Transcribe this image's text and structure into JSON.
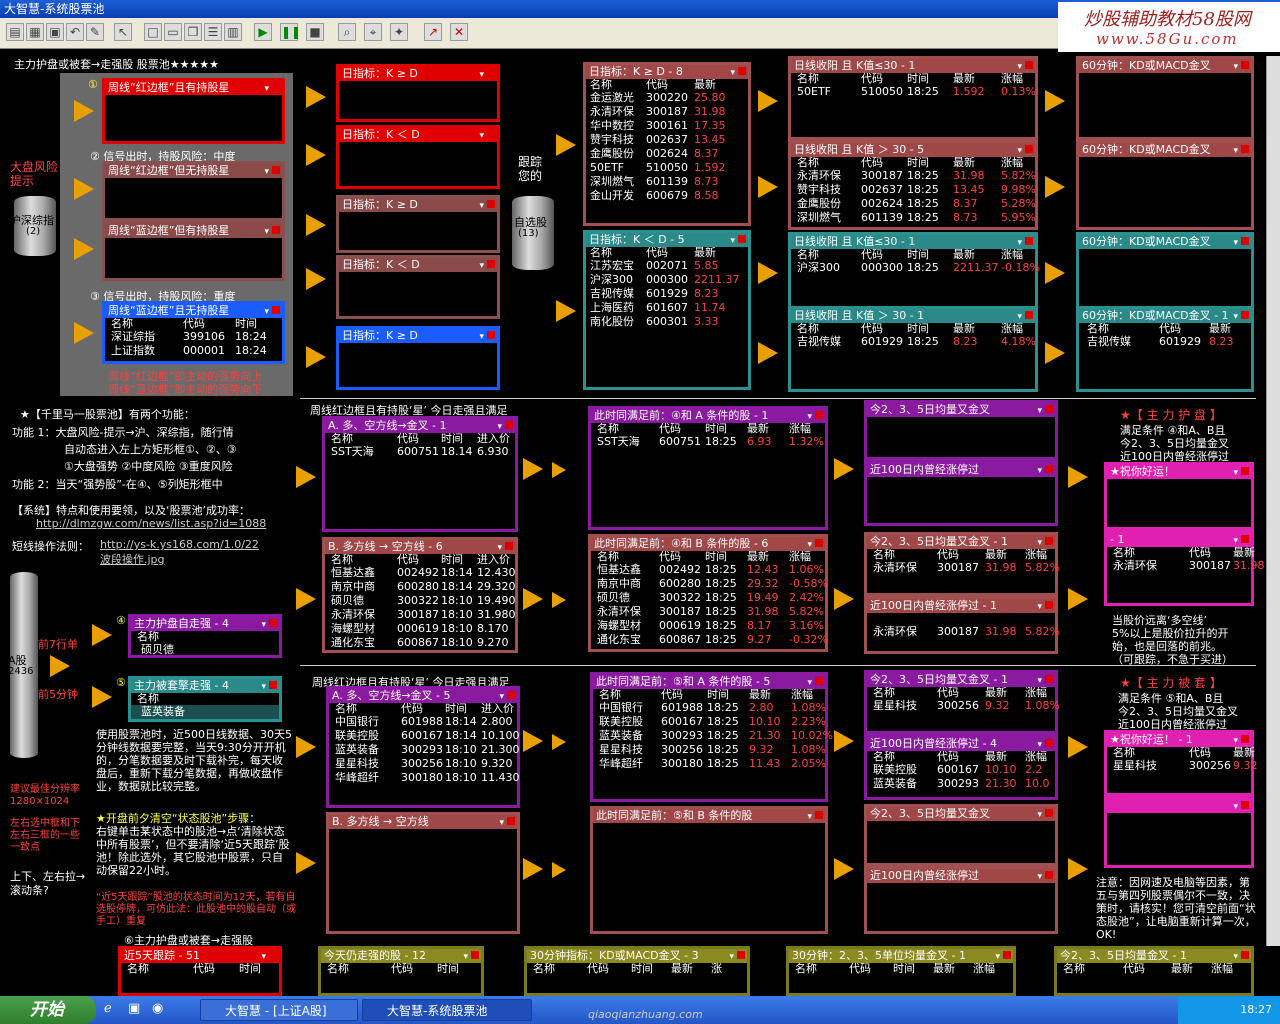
{
  "window": {
    "title": "大智慧-系统股票池"
  },
  "brand": {
    "line1": "炒股辅助教材58股网",
    "line2": "www.58Gu.com"
  },
  "header": {
    "subtitle": "主力护盘或被套→走强股  股票池★★★★★"
  },
  "left": {
    "p1_num": "①",
    "p1_title": "周线“红边框”且有持股星",
    "p2_label": "② 信号出时，持股风险：中度",
    "p2a_title": "周线“红边框”但无持股星",
    "p2b_title": "周线“蓝边框”但有持股星",
    "p3_label": "③ 信号出时，持股风险：重度",
    "p3_title": "周线“蓝边框”且无持股星",
    "p3_cols": [
      "名称",
      "代码",
      "时间"
    ],
    "p3_rows": [
      [
        "深证综指",
        "399106",
        "18:24"
      ],
      [
        "上证指数",
        "000001",
        "18:24"
      ]
    ],
    "warn_label": "大盘风险提示",
    "index_label": "沪深综指",
    "index_count": "(2)",
    "note1": "周线“红边框”即主动的强势向上",
    "note2": "周线“蓝边框”即主动的强势向下"
  },
  "col2": {
    "k1": "日指标：K ≥ D",
    "k2": "日指标：K ＜ D",
    "k3": "日指标：K ≥ D",
    "k4": "日指标：K ＜ D",
    "k5": "日指标：K ≥ D"
  },
  "track": {
    "label": "跟踪您的",
    "pool": "自选股",
    "count": "(13)"
  },
  "kd_up": {
    "title": "日指标：K ≥ D - 8",
    "cols": [
      "名称",
      "代码",
      "最新"
    ],
    "rows": [
      [
        "金运激光",
        "300220",
        "25.80"
      ],
      [
        "永清环保",
        "300187",
        "31.98"
      ],
      [
        "华中数控",
        "300161",
        "17.35"
      ],
      [
        "赞宇科技",
        "002637",
        "13.45"
      ],
      [
        "金鹰股份",
        "002624",
        "8.37"
      ],
      [
        "50ETF",
        "510050",
        "1.592"
      ],
      [
        "深圳燃气",
        "601139",
        "8.73"
      ],
      [
        "金山开发",
        "600679",
        "8.58"
      ]
    ]
  },
  "kd_down": {
    "title": "日指标：K ＜ D - 5",
    "cols": [
      "名称",
      "代码",
      "最新"
    ],
    "rows": [
      [
        "江苏宏宝",
        "002071",
        "5.85"
      ],
      [
        "沪深300",
        "000300",
        "2211.37"
      ],
      [
        "吉视传媒",
        "601929",
        "8.23"
      ],
      [
        "上海医药",
        "601607",
        "11.74"
      ],
      [
        "南化股份",
        "600301",
        "3.33"
      ]
    ]
  },
  "daily": {
    "a_title": "日线收阳 且 K值≤30 - 1",
    "cols": [
      "名称",
      "代码",
      "时间",
      "最新",
      "涨幅"
    ],
    "a_rows": [
      [
        "50ETF",
        "510050",
        "18:25",
        "1.592",
        "0.13%"
      ]
    ],
    "b_title": "日线收阳 且 K值 ＞ 30 - 5",
    "b_rows": [
      [
        "永清环保",
        "300187",
        "18:25",
        "31.98",
        "5.82%"
      ],
      [
        "赞宇科技",
        "002637",
        "18:25",
        "13.45",
        "9.98%"
      ],
      [
        "金鹰股份",
        "002624",
        "18:25",
        "8.37",
        "5.28%"
      ],
      [
        "深圳燃气",
        "601139",
        "18:25",
        "8.73",
        "5.95%"
      ]
    ],
    "c_title": "日线收阳 且 K值≤30 - 1",
    "c_rows": [
      [
        "沪深300",
        "000300",
        "18:25",
        "2211.37",
        "-0.18%"
      ]
    ],
    "d_title": "日线收阳 且 K值 ＞ 30 - 1",
    "d_rows": [
      [
        "吉视传媒",
        "601929",
        "18:25",
        "8.23",
        "4.18%"
      ]
    ]
  },
  "min60": {
    "a": "60分钟：KD或MACD金叉",
    "b": "60分钟：KD或MACD金叉",
    "c": "60分钟：KD或MACD金叉",
    "d": "60分钟：KD或MACD金叉 - 1",
    "d_cols": [
      "名称",
      "代码",
      "最新"
    ],
    "d_rows": [
      [
        "吉视传媒",
        "601929",
        "8.23"
      ]
    ]
  },
  "intro": {
    "title": "★【千里马一股票池】有两个功能：",
    "f1a": "功能 1：大盘风险-提示→沪、深综指，随行情",
    "f1b": "自动态进入左上方矩形框①、②、③",
    "f1c": "①大盘强势 ②中度风险 ③重度风险",
    "f2": "功能 2：当天“强势股”-在④、⑤列矩形框中",
    "sys": "【系统】特点和使用要领，以及‘股票池’成功率：",
    "url1": "http://dlmzgw.com/news/list.asp?id=1088",
    "law": "短线操作法则：",
    "url2": "http://ys-k.ys168.com/1.0/22",
    "url2b": "波段操作.jpg"
  },
  "row4": {
    "heading": "周线红边框且有持股‘星’ 今日走强且满足",
    "a_title": "A. 多、空方线→金叉 - 1",
    "a_cols": [
      "名称",
      "代码",
      "时间",
      "进入价"
    ],
    "a_rows": [
      [
        "SST天海",
        "600751",
        "18.14",
        "6.930"
      ]
    ],
    "b_title": "B. 多方线 → 空方线 - 6",
    "b_rows": [
      [
        "恒基达鑫",
        "002492",
        "18:14",
        "12.430"
      ],
      [
        "南京中商",
        "600280",
        "18:14",
        "29.320"
      ],
      [
        "硕贝德",
        "300322",
        "18:10",
        "19.490"
      ],
      [
        "永清环保",
        "300187",
        "18:10",
        "31.980"
      ],
      [
        "海螺型材",
        "000619",
        "18:10",
        "8.170"
      ],
      [
        "通化东宝",
        "600867",
        "18:10",
        "9.270"
      ]
    ],
    "main_title": "主力护盘自走强 - 4",
    "main_cols": [
      "名称"
    ],
    "main_rows": [
      [
        "硕贝德"
      ]
    ],
    "c_title": "此时同满足前：④和 A 条件的股 - 1",
    "c_cols": [
      "名称",
      "代码",
      "时间",
      "最新",
      "涨幅"
    ],
    "c_rows": [
      [
        "SST天海",
        "600751",
        "18:25",
        "6.93",
        "1.32%"
      ]
    ],
    "d_title": "此时同满足前：④和 B 条件的股 - 6",
    "d_rows": [
      [
        "恒基达鑫",
        "002492",
        "18:25",
        "12.43",
        "1.06%"
      ],
      [
        "南京中商",
        "600280",
        "18:25",
        "29.32",
        "-0.58%"
      ],
      [
        "硕贝德",
        "300322",
        "18:25",
        "19.49",
        "2.42%"
      ],
      [
        "永清环保",
        "300187",
        "18:25",
        "31.98",
        "5.82%"
      ],
      [
        "海螺型材",
        "000619",
        "18:25",
        "8.17",
        "3.16%"
      ],
      [
        "通化东宝",
        "600867",
        "18:25",
        "9.27",
        "-0.32%"
      ]
    ],
    "e_title": "今2、3、5日均量又金叉",
    "f_title": "近100日内曾经涨停过",
    "g_title": "今2、3、5日均量又金叉 - 1",
    "g_cols": [
      "名称",
      "代码",
      "最新",
      "涨幅"
    ],
    "g_rows": [
      [
        "永清环保",
        "300187",
        "31.98",
        "5.82%"
      ]
    ],
    "h_title": "近100日内曾经涨停过 - 1",
    "h_rows": [
      [
        "永清环保",
        "300187",
        "31.98",
        "5.82%"
      ]
    ],
    "guard_title": "★【 主 力 护 盘 】",
    "guard_l1": "满足条件 ④和A、B且",
    "guard_l2": "今2、3、5日均量金叉",
    "guard_l3": "近100日内曾经涨停过",
    "wish_title": "★祝你好运！",
    "wish2_title": "- 1",
    "wish2_cols": [
      "名称",
      "代码",
      "最新"
    ],
    "wish2_rows": [
      [
        "永清环保",
        "300187",
        "31.98"
      ]
    ],
    "note1": "当股价远离‘多空线’",
    "note2": "5%以上是股价拉升的开",
    "note3": "始，也是回落的前兆。",
    "note4": "（可跟踪，不急于买进）"
  },
  "row5": {
    "heading": "周线红边框且有持股‘星’ 今日走强且满足",
    "a_title": "A. 多、空方线→金叉 - 5",
    "a_cols": [
      "名称",
      "代码",
      "时间",
      "进入价"
    ],
    "a_rows": [
      [
        "中国银行",
        "601988",
        "18:14",
        "2.800"
      ],
      [
        "联美控股",
        "600167",
        "18:14",
        "10.100"
      ],
      [
        "蓝英装备",
        "300293",
        "18:10",
        "21.300"
      ],
      [
        "星星科技",
        "300256",
        "18:10",
        "9.320"
      ],
      [
        "华峰超纤",
        "300180",
        "18:10",
        "11.430"
      ]
    ],
    "b_title": "B. 多方线 → 空方线",
    "trap_num": "⑤",
    "trap_title": "主力被套擎走强 - 4",
    "trap_cols": [
      "名称"
    ],
    "trap_rows": [
      [
        "蓝英装备"
      ]
    ],
    "c_title": "此时同满足前：⑤和 A 条件的股 - 5",
    "c_cols": [
      "名称",
      "代码",
      "时间",
      "最新",
      "涨幅"
    ],
    "c_rows": [
      [
        "中国银行",
        "601988",
        "18:25",
        "2.80",
        "1.08%"
      ],
      [
        "联美控股",
        "600167",
        "18:25",
        "10.10",
        "2.23%"
      ],
      [
        "蓝英装备",
        "300293",
        "18:25",
        "21.30",
        "10.02%"
      ],
      [
        "星星科技",
        "300256",
        "18:25",
        "9.32",
        "1.08%"
      ],
      [
        "华峰超纤",
        "300180",
        "18:25",
        "11.43",
        "2.05%"
      ]
    ],
    "d_title": "此时同满足前：⑤和 B 条件的股",
    "e_title": "今2、3、5日均量又金叉 - 1",
    "e_cols": [
      "名称",
      "代码",
      "最新",
      "涨幅"
    ],
    "e_rows": [
      [
        "星星科技",
        "300256",
        "9.32",
        "1.08%"
      ]
    ],
    "f_title": "近100日内曾经涨停过 - 4",
    "f_rows": [
      [
        "联美控股",
        "600167",
        "10.10",
        "2.2"
      ],
      [
        "蓝英装备",
        "300293",
        "21.30",
        "10.0"
      ]
    ],
    "g_title": "今2、3、5日均量又金叉",
    "h_title": "近100日内曾经涨停过",
    "trap_head": "★【 主 力 被 套 】",
    "trap_l1": "满足条件 ⑤和A、B且",
    "trap_l2": "今2、3、5日均量又金叉",
    "trap_l3": "近100日内曾经涨停过",
    "wish_title": "★祝你好运！ - 1",
    "wish_cols": [
      "名称",
      "代码",
      "最新"
    ],
    "wish_rows": [
      [
        "星星科技",
        "300256",
        "9.32"
      ]
    ],
    "note": "注意：因网速及电脑等因素，第五与第四列股票偶尔不一致，决策时，请核实！您可清空前面“状态股池”，让电脑重新计算一次，OK!"
  },
  "leftlower": {
    "ashare": "A股",
    "ashare_n": "2436",
    "lbl1": "前7行单",
    "lbl2": "前5分钟",
    "use": "使用股票池时，近500日线数据、30天5分钟线数据要完整，当天9:30分开开机的，分笔数据要及时下载补完，每天收盘后，重新下载分笔数据，再做收盘作业，数据就比较完整。",
    "clear_title": "★开盘前夕清空“状态股池”步骤：",
    "clear_body": "右键单击某状态中的股池→点‘清除状态中所有股票’，但不要清除‘近5天跟踪’股池！除此选外，其它股池中股票，只自动保留22小时。",
    "res": "建议最佳分辨率 1280×1024",
    "tip": "左右选中框和下左右三框的一些一致点",
    "scroll": "上下、左右拉→滚动条?",
    "track_note": "“近5天跟踪”股池的状态时间为12天，若有自选股停牌，可仿此法：此股池中的股自动（或手工）重复",
    "bottom_label": "⑥主力护盘或被套→走强股"
  },
  "bottom": {
    "b1": "近5天跟踪 - 51",
    "b1_cols": [
      "名称",
      "代码",
      "时间"
    ],
    "b2": "今天仍走强的股 - 12",
    "b2_cols": [
      "名称",
      "代码",
      "时间"
    ],
    "b3": "30分钟指标：KD或MACD金叉 - 3",
    "b3_cols": [
      "名称",
      "代码",
      "时间",
      "最新",
      "涨"
    ],
    "b4": "30分钟：2、3、5单位均量金叉 - 1",
    "b4_cols": [
      "名称",
      "代码",
      "时间",
      "最新",
      "涨幅"
    ],
    "b5": "今2、3、5日均量金叉 - 1",
    "b5_cols": [
      "名称",
      "代码",
      "最新",
      "涨幅"
    ]
  },
  "taskbar": {
    "start": "开始",
    "t1": "大智慧 - [上证A股]",
    "t2": "大智慧-系统股票池",
    "watermark": "qiaoqianzhuang.com",
    "clock": "18:27"
  },
  "colors": {
    "accent_red": "#e00000",
    "accent_blue": "#1a5cff",
    "teal": "#2a9090",
    "purple": "#8a1aa0",
    "magenta": "#e020b0"
  }
}
